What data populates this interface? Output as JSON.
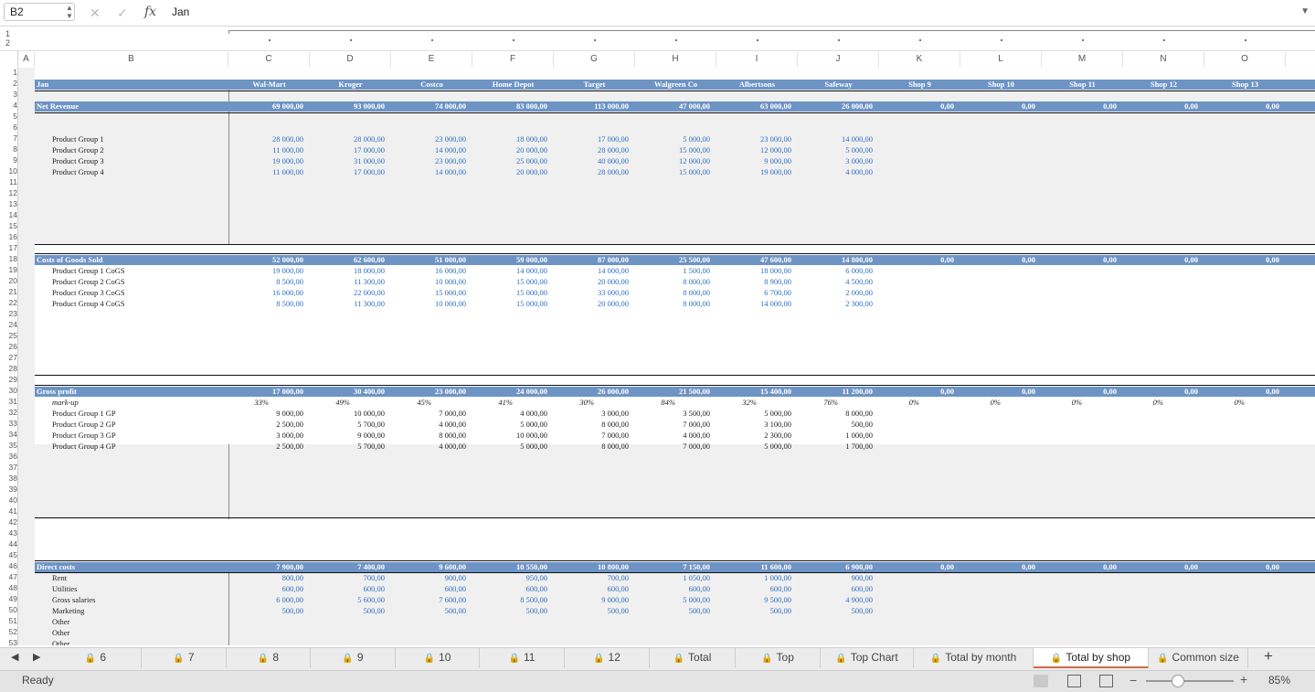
{
  "formula_bar": {
    "cell_ref": "B2",
    "cancel_icon": "✕",
    "confirm_icon": "✓",
    "fx": "fx",
    "value": "Jan"
  },
  "column_headers": [
    "A",
    "B",
    "C",
    "D",
    "E",
    "F",
    "G",
    "H",
    "I",
    "J",
    "K",
    "L",
    "M",
    "N",
    "O"
  ],
  "outline_levels": [
    "1",
    "2"
  ],
  "row_numbers": [
    "1",
    "2",
    "3",
    "4",
    "5",
    "6",
    "7",
    "8",
    "9",
    "10",
    "11",
    "12",
    "13",
    "14",
    "15",
    "16",
    "17",
    "18",
    "19",
    "20",
    "21",
    "22",
    "23",
    "24",
    "25",
    "26",
    "27",
    "28",
    "29",
    "30",
    "31",
    "32",
    "33",
    "34",
    "35",
    "36",
    "37",
    "38",
    "39",
    "40",
    "41",
    "42",
    "43",
    "44",
    "45",
    "46",
    "47",
    "48",
    "49",
    "50",
    "51",
    "52",
    "53"
  ],
  "sheet": {
    "month_label": "Jan",
    "shops": [
      "Wal-Mart",
      "Kroger",
      "Costco",
      "Home Depot",
      "Target",
      "Walgreen Co",
      "Albertsons",
      "Safeway",
      "Shop 9",
      "Shop 10",
      "Shop 11",
      "Shop 12",
      "Shop 13"
    ],
    "net_revenue": {
      "label": "Net Revenue",
      "values": [
        "69 000,00",
        "93 000,00",
        "74 000,00",
        "83 000,00",
        "113 000,00",
        "47 000,00",
        "63 000,00",
        "26 000,00",
        "0,00",
        "0,00",
        "0,00",
        "0,00",
        "0,00"
      ]
    },
    "revenue_rows": [
      {
        "label": "Product Group 1",
        "values": [
          "28 000,00",
          "28 000,00",
          "23 000,00",
          "18 000,00",
          "17 000,00",
          "5 000,00",
          "23 000,00",
          "14 000,00"
        ]
      },
      {
        "label": "Product Group 2",
        "values": [
          "11 000,00",
          "17 000,00",
          "14 000,00",
          "20 000,00",
          "28 000,00",
          "15 000,00",
          "12 000,00",
          "5 000,00"
        ]
      },
      {
        "label": "Product Group 3",
        "values": [
          "19 000,00",
          "31 000,00",
          "23 000,00",
          "25 000,00",
          "40 000,00",
          "12 000,00",
          "9 000,00",
          "3 000,00"
        ]
      },
      {
        "label": "Product Group 4",
        "values": [
          "11 000,00",
          "17 000,00",
          "14 000,00",
          "20 000,00",
          "28 000,00",
          "15 000,00",
          "19 000,00",
          "4 000,00"
        ]
      }
    ],
    "cogs": {
      "label": "Costs of Goods Sold",
      "values": [
        "52 000,00",
        "62 600,00",
        "51 000,00",
        "59 000,00",
        "87 000,00",
        "25 500,00",
        "47 600,00",
        "14 800,00",
        "0,00",
        "0,00",
        "0,00",
        "0,00",
        "0,00"
      ]
    },
    "cogs_rows": [
      {
        "label": "Product Group 1 CoGS",
        "values": [
          "19 000,00",
          "18 000,00",
          "16 000,00",
          "14 000,00",
          "14 000,00",
          "1 500,00",
          "18 000,00",
          "6 000,00"
        ]
      },
      {
        "label": "Product Group 2 CoGS",
        "values": [
          "8 500,00",
          "11 300,00",
          "10 000,00",
          "15 000,00",
          "20 000,00",
          "8 000,00",
          "8 900,00",
          "4 500,00"
        ]
      },
      {
        "label": "Product Group 3 CoGS",
        "values": [
          "16 000,00",
          "22 000,00",
          "15 000,00",
          "15 000,00",
          "33 000,00",
          "8 000,00",
          "6 700,00",
          "2 000,00"
        ]
      },
      {
        "label": "Product Group 4 CoGS",
        "values": [
          "8 500,00",
          "11 300,00",
          "10 000,00",
          "15 000,00",
          "20 000,00",
          "8 000,00",
          "14 000,00",
          "2 300,00"
        ]
      }
    ],
    "gross_profit": {
      "label": "Gross profit",
      "values": [
        "17 000,00",
        "30 400,00",
        "23 000,00",
        "24 000,00",
        "26 000,00",
        "21 500,00",
        "15 400,00",
        "11 200,00",
        "0,00",
        "0,00",
        "0,00",
        "0,00",
        "0,00"
      ]
    },
    "markup": {
      "label": "mark-up",
      "values": [
        "33%",
        "49%",
        "45%",
        "41%",
        "30%",
        "84%",
        "32%",
        "76%",
        "0%",
        "0%",
        "0%",
        "0%",
        "0%"
      ]
    },
    "gp_rows": [
      {
        "label": "Product Group 1 GP",
        "values": [
          "9 000,00",
          "10 000,00",
          "7 000,00",
          "4 000,00",
          "3 000,00",
          "3 500,00",
          "5 000,00",
          "8 000,00"
        ]
      },
      {
        "label": "Product Group 2 GP",
        "values": [
          "2 500,00",
          "5 700,00",
          "4 000,00",
          "5 000,00",
          "8 000,00",
          "7 000,00",
          "3 100,00",
          "500,00"
        ]
      },
      {
        "label": "Product Group 3 GP",
        "values": [
          "3 000,00",
          "9 000,00",
          "8 000,00",
          "10 000,00",
          "7 000,00",
          "4 000,00",
          "2 300,00",
          "1 000,00"
        ]
      },
      {
        "label": "Product Group 4 GP",
        "values": [
          "2 500,00",
          "5 700,00",
          "4 000,00",
          "5 000,00",
          "8 000,00",
          "7 000,00",
          "5 000,00",
          "1 700,00"
        ]
      }
    ],
    "direct_costs": {
      "label": "Direct costs",
      "values": [
        "7 900,00",
        "7 400,00",
        "9 600,00",
        "10 550,00",
        "10 800,00",
        "7 150,00",
        "11 600,00",
        "6 900,00",
        "0,00",
        "0,00",
        "0,00",
        "0,00",
        "0,00"
      ]
    },
    "dc_rows": [
      {
        "label": "Rent",
        "values": [
          "800,00",
          "700,00",
          "900,00",
          "950,00",
          "700,00",
          "1 050,00",
          "1 000,00",
          "900,00"
        ]
      },
      {
        "label": "Utilities",
        "values": [
          "600,00",
          "600,00",
          "600,00",
          "600,00",
          "600,00",
          "600,00",
          "600,00",
          "600,00"
        ]
      },
      {
        "label": "Gross salaries",
        "values": [
          "6 000,00",
          "5 600,00",
          "7 600,00",
          "8 500,00",
          "9 000,00",
          "5 000,00",
          "9 500,00",
          "4 900,00"
        ]
      },
      {
        "label": "Marketing",
        "values": [
          "500,00",
          "500,00",
          "500,00",
          "500,00",
          "500,00",
          "500,00",
          "500,00",
          "500,00"
        ]
      },
      {
        "label": "Other",
        "values": []
      },
      {
        "label": "Other",
        "values": []
      },
      {
        "label": "Other",
        "values": []
      }
    ]
  },
  "tabs": [
    {
      "label": "6",
      "locked": true
    },
    {
      "label": "7",
      "locked": true
    },
    {
      "label": "8",
      "locked": true
    },
    {
      "label": "9",
      "locked": true
    },
    {
      "label": "10",
      "locked": true
    },
    {
      "label": "11",
      "locked": true
    },
    {
      "label": "12",
      "locked": true
    },
    {
      "label": "Total",
      "locked": true
    },
    {
      "label": "Top",
      "locked": true
    },
    {
      "label": "Top Chart",
      "locked": true
    },
    {
      "label": "Total by month",
      "locked": true
    },
    {
      "label": "Total by shop",
      "locked": true,
      "active": true
    },
    {
      "label": "Common size",
      "locked": true
    }
  ],
  "add_sheet": "+",
  "status": {
    "text": "Ready",
    "zoom": "85%",
    "zoom_minus": "−",
    "zoom_plus": "+",
    "zoom_fraction": 0.35
  },
  "colors": {
    "band": "#6e94c5",
    "value_blue": "#2d6fc2",
    "active_tab_accent": "#cf6a4b"
  }
}
